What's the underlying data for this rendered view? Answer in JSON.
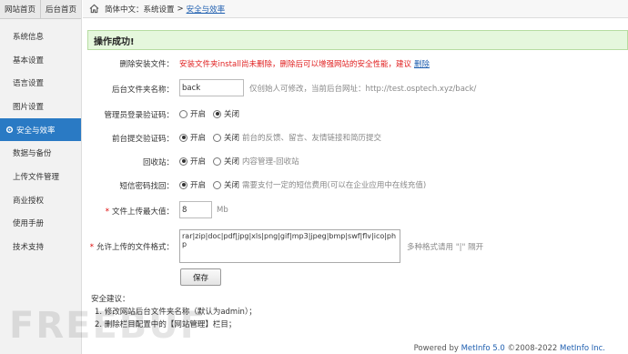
{
  "sidebar": {
    "tabs": [
      {
        "label": "网站首页"
      },
      {
        "label": "后台首页"
      }
    ],
    "items": [
      {
        "label": "系统信息",
        "active": false
      },
      {
        "label": "基本设置",
        "active": false
      },
      {
        "label": "语言设置",
        "active": false
      },
      {
        "label": "图片设置",
        "active": false
      },
      {
        "label": "安全与效率",
        "active": true
      },
      {
        "label": "数据与备份",
        "active": false
      },
      {
        "label": "上传文件管理",
        "active": false
      },
      {
        "label": "商业授权",
        "active": false
      },
      {
        "label": "使用手册",
        "active": false
      },
      {
        "label": "技术支持",
        "active": false
      }
    ]
  },
  "breadcrumb": {
    "prefix": "简体中文：系统设置",
    "sep": ">",
    "current": "安全与效率"
  },
  "banner": {
    "text": "操作成功!"
  },
  "form": {
    "delete_install": {
      "label": "删除安装文件：",
      "warning": "安装文件夹install尚未删除，删除后可以增强网站的安全性能，建议",
      "link": "删除"
    },
    "admin_folder": {
      "label": "后台文件夹名称：",
      "value": "back",
      "hint": "仅创始人可修改，当前后台网址：http://test.osptech.xyz/back/"
    },
    "admin_login_captcha": {
      "label": "管理员登录验证码：",
      "on_label": "开启",
      "off_label": "关闭",
      "selected": "off"
    },
    "front_captcha": {
      "label": "前台提交验证码：",
      "on_label": "开启",
      "off_label": "关闭",
      "hint": "前台的反馈、留言、友情链接和简历提交",
      "selected": "on"
    },
    "recycle": {
      "label": "回收站：",
      "on_label": "开启",
      "off_label": "关闭",
      "hint": "内容管理-回收站",
      "selected": "on"
    },
    "sms_recover": {
      "label": "短信密码找回：",
      "on_label": "开启",
      "off_label": "关闭",
      "hint": "需要支付一定的短信费用(可以在企业应用中在线充值)",
      "selected": "on"
    },
    "max_upload": {
      "required": "*",
      "label": "文件上传最大值：",
      "value": "8",
      "unit": "Mb"
    },
    "allowed_types": {
      "required": "*",
      "label": "允许上传的文件格式：",
      "value": "rar|zip|doc|pdf|jpg|xls|png|gif|mp3|jpeg|bmp|swf|flv|ico|php",
      "hint": "多种格式请用 \"|\" 隔开"
    },
    "save_label": "保存"
  },
  "advice": {
    "title": "安全建议：",
    "items": [
      "1. 修改网站后台文件夹名称（默认为admin）；",
      "2. 删除栏目配置中的【网站管理】栏目；"
    ]
  },
  "footer": {
    "prefix": "Powered by",
    "brand1": "MetInfo 5.0",
    "copy": "©2008-2022",
    "brand2": "MetInfo Inc."
  },
  "watermark": "FREEBUF",
  "colors": {
    "accent": "#2a7ac4",
    "link": "#1f5fb0",
    "warning": "#e02020",
    "success_bg": "#e5f7dd"
  }
}
